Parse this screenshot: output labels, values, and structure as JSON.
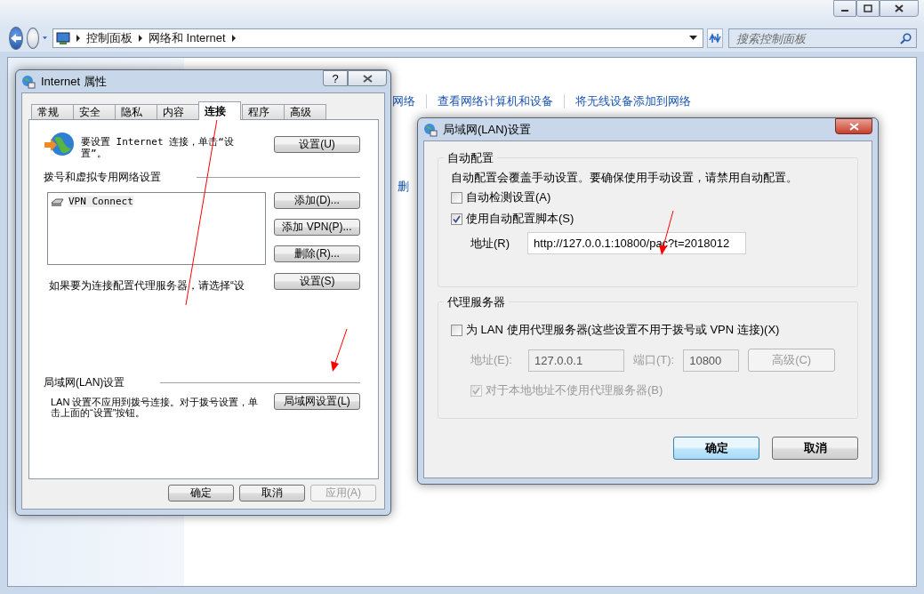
{
  "explorer": {
    "breadcrumb": [
      "控制面板",
      "网络和 Internet"
    ],
    "search": {
      "placeholder": "搜索控制面板"
    },
    "links": [
      "网络",
      "查看网络计算机和设备",
      "将无线设备添加到网络"
    ],
    "partial_link": "删"
  },
  "internet_properties": {
    "title": "Internet 属性",
    "help_button": "?",
    "tabs": [
      {
        "label": "常规",
        "selected": false
      },
      {
        "label": "安全",
        "selected": false
      },
      {
        "label": "隐私",
        "selected": false
      },
      {
        "label": "内容",
        "selected": false
      },
      {
        "label": "连接",
        "selected": true
      },
      {
        "label": "程序",
        "selected": false
      },
      {
        "label": "高级",
        "selected": false
      }
    ],
    "setup": {
      "text": "要设置 Internet 连接，单击“设置”。",
      "button": "设置(U)"
    },
    "vpn_section": {
      "heading": "拨号和虚拟专用网络设置",
      "connections": [
        "VPN Connect"
      ],
      "buttons": [
        "添加(D)...",
        "添加 VPN(P)...",
        "删除(R)..."
      ]
    },
    "proxy": {
      "text": "如果要为连接配置代理服务器，请选择“设",
      "button": "设置(S)"
    },
    "lan_section": {
      "heading": "局域网(LAN)设置",
      "text": "LAN 设置不应用到拨号连接。对于拨号设置，单击上面的“设置”按钮。",
      "button": "局域网设置(L)"
    },
    "buttons": [
      {
        "label": "确定",
        "disabled": false
      },
      {
        "label": "取消",
        "disabled": false
      },
      {
        "label": "应用(A)",
        "disabled": true
      }
    ]
  },
  "lan_dialog": {
    "title": "局域网(LAN)设置",
    "auto_config": {
      "heading": "自动配置",
      "description": "自动配置会覆盖手动设置。要确保使用手动设置，请禁用自动配置。",
      "options": [
        {
          "label": "自动检测设置(A)",
          "checked": false
        },
        {
          "label": "使用自动配置脚本(S)",
          "checked": true
        }
      ],
      "address": {
        "label": "地址(R)",
        "value": "http://127.0.0.1:10800/pac?t=2018012"
      }
    },
    "proxy": {
      "heading": "代理服务器",
      "use_proxy": {
        "label": "为 LAN 使用代理服务器(这些设置不用于拨号或 VPN 连接)(X)",
        "checked": false
      },
      "address": {
        "label": "地址(E):",
        "value": "127.0.0.1",
        "disabled": true
      },
      "port": {
        "label": "端口(T):",
        "value": "10800",
        "disabled": true
      },
      "advanced_button": {
        "label": "高级(C)",
        "disabled": true
      },
      "bypass_local": {
        "label": "对于本地地址不使用代理服务器(B)",
        "checked": true,
        "disabled": true
      }
    },
    "buttons": [
      {
        "label": "确定",
        "default": true
      },
      {
        "label": "取消",
        "default": false
      }
    ]
  }
}
